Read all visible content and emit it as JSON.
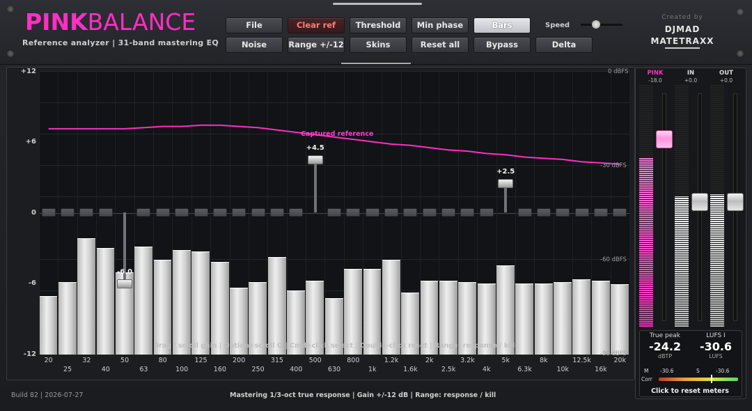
{
  "header": {
    "brand_bold": "PINK",
    "brand_light": "BALANCE",
    "subtitle": "Reference analyzer  |  31-band mastering EQ",
    "created_by": "Created by",
    "author_line1": "DJMAD",
    "author_line2": "MATETRAXX",
    "speed_label": "Speed",
    "speed_level": 0.35
  },
  "toolbar": {
    "file": "File",
    "clear_ref": "Clear ref",
    "threshold": "Threshold",
    "min_phase": "Min phase",
    "bars": "Bars",
    "noise": "Noise",
    "range": "Range +/-12",
    "skins": "Skins",
    "reset_all": "Reset all",
    "bypass": "Bypass",
    "delta": "Delta"
  },
  "graph": {
    "y_labels": [
      "+12",
      "+6",
      "0",
      "-6",
      "-12"
    ],
    "dbfs_labels": [
      "0 dBFS",
      "-30 dBFS",
      "-60 dBFS",
      "-90 dBFS"
    ],
    "reference_label": "Captured reference",
    "hint": "Drag / scroll gain  |  Option+scroll Q  |  Cmd+click select  |  Double-click reset  |  Range: response / kill",
    "x_top": [
      "20",
      "32",
      "50",
      "80",
      "125",
      "200",
      "315",
      "500",
      "800",
      "1.2k",
      "2k",
      "3.2k",
      "5k",
      "8k",
      "12.5k",
      "20k"
    ],
    "x_bottom": [
      "25",
      "40",
      "63",
      "100",
      "160",
      "250",
      "400",
      "630",
      "1k",
      "1.6k",
      "2.5k",
      "4k",
      "6.3k",
      "10k",
      "16k"
    ],
    "band_gains": [
      0,
      0,
      0,
      0,
      -6.0,
      0,
      0,
      0,
      0,
      0,
      0,
      0,
      0,
      0,
      4.5,
      0,
      0,
      0,
      0,
      0,
      0,
      0,
      0,
      0,
      2.5,
      0,
      0,
      0,
      0,
      0,
      0
    ],
    "gain_labels": {
      "b5": "-6.0",
      "b15": "+4.5",
      "b25": "+2.5"
    },
    "bars_db": [
      -7.1,
      -5.9,
      -2.2,
      -3.0,
      -5.1,
      -2.9,
      -4.0,
      -3.2,
      -3.3,
      -4.2,
      -6.4,
      -5.9,
      -3.8,
      -6.6,
      -5.8,
      -7.3,
      -4.8,
      -4.8,
      -4.0,
      -6.8,
      -5.8,
      -5.8,
      -5.9,
      -6.0,
      -4.5,
      -6.0,
      -6.0,
      -5.9,
      -5.7,
      -5.8,
      -6.1
    ],
    "reference_db": [
      7.1,
      7.1,
      7.1,
      7.1,
      7.1,
      7.2,
      7.3,
      7.3,
      7.4,
      7.4,
      7.3,
      7.2,
      7.0,
      6.8,
      6.6,
      6.4,
      6.2,
      6.0,
      5.8,
      5.7,
      5.5,
      5.3,
      5.2,
      5.0,
      4.9,
      4.7,
      4.6,
      4.5,
      4.3,
      4.2,
      4.1
    ]
  },
  "footer": {
    "build": "Build 82  |  2026-07-27",
    "info": "Mastering 1/3-oct true response  |  Gain +/-12 dB  |  Range: response / kill"
  },
  "meters": {
    "pink_label": "PINK",
    "pink_value": "-18.0",
    "in_label": "IN",
    "in_value": "+0.0",
    "out_label": "OUT",
    "out_value": "+0.0",
    "pink_level": 0.7,
    "in_level": 0.54,
    "out_level": 0.55,
    "pink_fader": 0.78,
    "in_fader": 0.52,
    "out_fader": 0.52,
    "true_peak_label": "True peak",
    "true_peak_value": "-24.2",
    "true_peak_unit": "dBTP",
    "lufs_label": "LUFS I",
    "lufs_value": "-30.6",
    "lufs_unit": "LUFS",
    "m_label": "M",
    "m_value": "-30.6",
    "s_label": "S",
    "s_value": "-30.6",
    "corr_label": "Corr",
    "reset_label": "Click to reset meters",
    "colors": {
      "pink": "#ff2ec4",
      "meter": "#d8d8d8"
    }
  }
}
